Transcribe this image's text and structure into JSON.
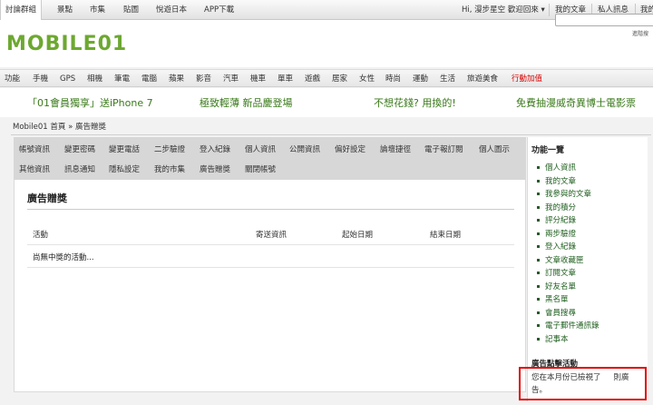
{
  "topbar": {
    "tabs": [
      "討論群組",
      "景點",
      "市集",
      "貼圖",
      "悅遊日本",
      "APP下載"
    ],
    "greeting": "Hi, 漫步星空 歡迎回來 ▾",
    "links": [
      "我的文章",
      "私人訊息",
      "我的"
    ]
  },
  "header": {
    "logo": "MOBILE01",
    "search_placeholder": "",
    "advanced_search": "進階搜"
  },
  "catnav": {
    "items": [
      "功能",
      "手機",
      "GPS",
      "相機",
      "筆電",
      "電腦",
      "蘋果",
      "影音",
      "汽車",
      "機車",
      "單車",
      "遊戲",
      "居家",
      "女性",
      "時尚",
      "運動",
      "生活",
      "旅遊美食"
    ],
    "highlight": "行動加值",
    "highlight_color": "#d40000"
  },
  "promos": [
    "「01會員獨享」送iPhone 7",
    "極致輕薄 新品慶登場",
    "不想花錢? 用換的!",
    "免費抽漫威奇異博士電影票"
  ],
  "breadcrumb": "Mobile01 首頁 » 廣告贈獎",
  "settings_tabs": {
    "row1": [
      "帳號資訊",
      "變更密碼",
      "變更電話",
      "二步驗證",
      "登入紀錄",
      "個人資訊",
      "公開資訊",
      "偏好設定",
      "論壇捷徑",
      "電子報訂閱",
      "個人圖示"
    ],
    "row2": [
      "其他資訊",
      "訊息通知",
      "隱私設定",
      "我的市集",
      "廣告贈獎",
      "關閉帳號"
    ]
  },
  "main": {
    "title": "廣告贈獎",
    "columns": [
      "活動",
      "寄送資訊",
      "起始日期",
      "結束日期"
    ],
    "empty_message": "尚無中獎的活動..."
  },
  "sidebar": {
    "title": "功能一覽",
    "items": [
      "個人資訊",
      "我的文章",
      "我參與的文章",
      "我的積分",
      "評分紀錄",
      "兩步驗證",
      "登入紀錄",
      "文章收藏匣",
      "訂閱文章",
      "好友名單",
      "黑名單",
      "會員搜尋",
      "電子郵件通訊錄",
      "記事本"
    ],
    "ad_title": "廣告點擊活動",
    "ad_text_1": "您在本月份已檢視了",
    "ad_text_2": "則廣",
    "ad_text_3": "告。"
  },
  "colors": {
    "brand_green": "#6da831",
    "promo_green": "#3a7a1a",
    "highlight_border": "#e00000"
  }
}
